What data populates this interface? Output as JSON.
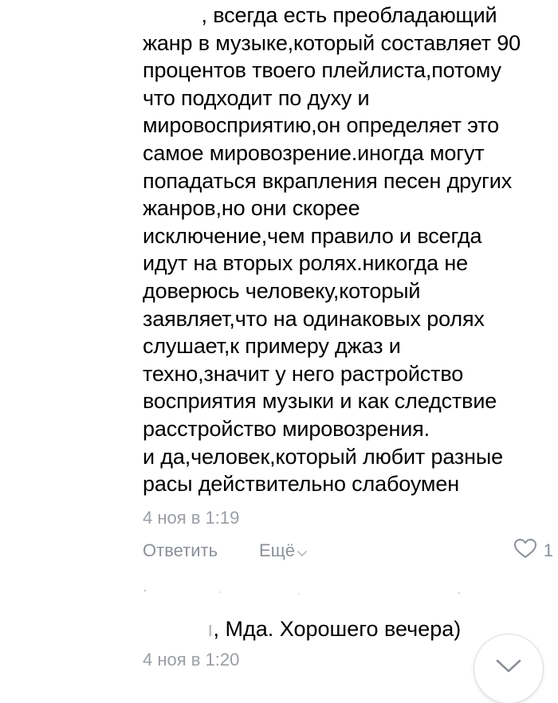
{
  "comment": {
    "author_name": "          ",
    "first_line_rest": ", всегда есть преобладающий",
    "lines": [
      "жанр в музыке,который составляет 90",
      "процентов твоего плейлиста,потому",
      "что подходит по духу и",
      "мировосприятию,он определяет это",
      "самое мировозрение.иногда могут",
      "попадаться вкрапления песен других",
      "жанров,но они скорее",
      "исключение,чем правило и всегда",
      "идут на вторых ролях.никогда не",
      "доверюсь человеку,который",
      "заявляет,что на одинаковых ролях",
      "слушает,к примеру джаз и",
      "техно,значит у него растройство",
      "восприятия музыки и как следствие",
      "расстройство мировозрения.",
      "и да,человек,который любит разные",
      "расы действительно слабоумен"
    ],
    "timestamp": "4 ноя в 1:19",
    "actions": {
      "reply": "Ответить",
      "more": "Ещё",
      "likes": "1"
    }
  },
  "reply": {
    "author_mark": "ı",
    "text": ", Мда. Хорошего вечера)",
    "timestamp": "4 ноя в 1:20"
  },
  "icons": {
    "more_chevron": "chevron-down-icon",
    "like": "heart-icon",
    "scroll": "chevron-down-icon"
  },
  "colors": {
    "text": "#000000",
    "secondary": "#8b9098",
    "timestamp": "#9a9ea5",
    "background": "#ffffff"
  }
}
